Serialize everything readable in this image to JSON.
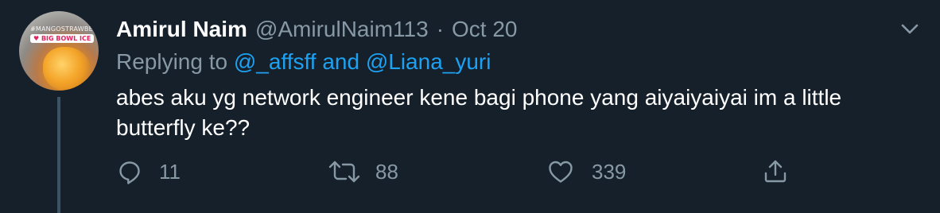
{
  "tweet": {
    "author_name": "Amirul Naim",
    "author_handle": "@AmirulNaim113",
    "separator": "·",
    "date": "Oct 20",
    "replying_prefix": "Replying to",
    "reply_mention_1": "@_affsff",
    "reply_conjunction": "and",
    "reply_mention_2": "@Liana_yuri",
    "text": "abes aku yg network engineer kene bagi phone yang aiyaiyaiyai im a little butterfly ke??"
  },
  "avatar": {
    "overlay_top": "#MANGOSTRAWBERRY",
    "overlay_badge": "♥ BIG BOWL ICE"
  },
  "actions": {
    "replies": "11",
    "retweets": "88",
    "likes": "339"
  },
  "icons": {
    "reply": "reply-icon",
    "retweet": "retweet-icon",
    "like": "heart-icon",
    "share": "share-icon",
    "caret": "chevron-down-icon"
  },
  "colors": {
    "background": "#15202b",
    "secondary_text": "#8899a6",
    "link": "#1da1f2",
    "thread_line": "#3d5466"
  }
}
